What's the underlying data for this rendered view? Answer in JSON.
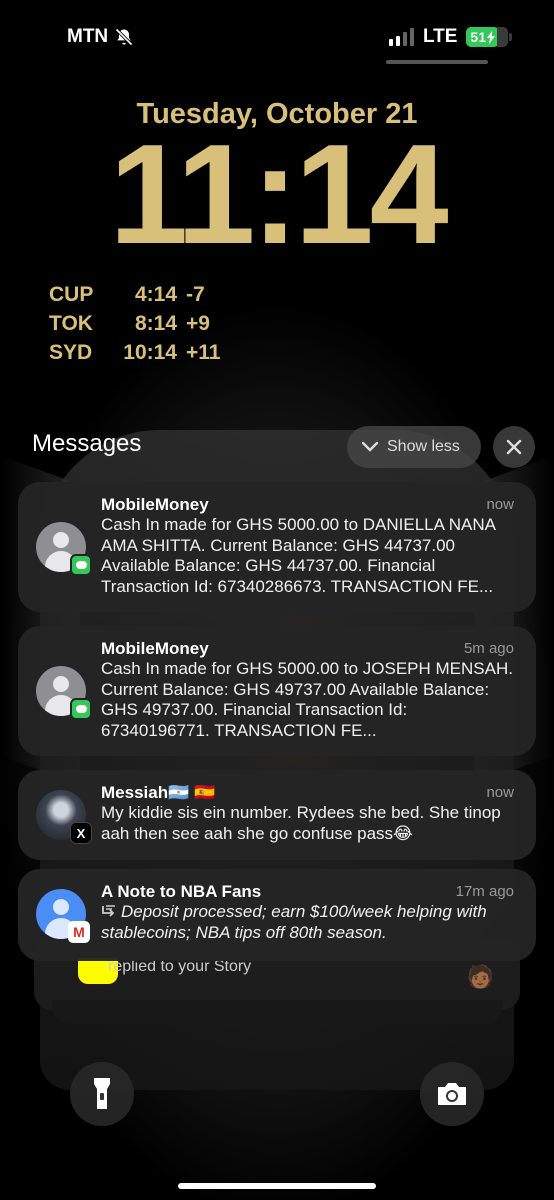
{
  "status_bar": {
    "carrier": "MTN",
    "network": "LTE",
    "battery": "51",
    "silent_icon": "bell-slash-icon",
    "charging_icon": "bolt-icon"
  },
  "lock_screen": {
    "date": "Tuesday, October 21",
    "time": "11:14",
    "world_clocks": [
      {
        "city": "CUP",
        "time": "4:14",
        "offset": "-7"
      },
      {
        "city": "TOK",
        "time": "8:14",
        "offset": "+9"
      },
      {
        "city": "SYD",
        "time": "10:14",
        "offset": "+11"
      }
    ],
    "accent_color": "#d9c07a"
  },
  "notification_group": {
    "title": "Messages",
    "show_less_label": "Show less",
    "close_icon": "close-icon"
  },
  "notifications": [
    {
      "title": "MobileMoney",
      "time": "now",
      "body": "Cash In made for GHS 5000.00 to DANIELLA NANA AMA SHITTA. Current Balance: GHS 44737.00 Available Balance: GHS 44737.00. Financial Transaction Id: 67340286673. TRANSACTION FE..."
    },
    {
      "title": "MobileMoney",
      "time": "5m ago",
      "body": "Cash In made for GHS 5000.00 to JOSEPH MENSAH. Current Balance: GHS 49737.00 Available Balance: GHS 49737.00. Financial Transaction Id: 67340196771. TRANSACTION FE..."
    },
    {
      "title": "Messiah🇦🇷 🇪🇸",
      "time": "now",
      "body": "My kiddie sis ein number. Rydees she bed. She tinop aah then see aah she go confuse pass😂"
    },
    {
      "title": "A Note to NBA Fans",
      "time": "17m ago",
      "count": "2",
      "body": "Deposit processed; earn $100/week helping with stablecoins; NBA tips off 80th season."
    }
  ],
  "stacked_notification": {
    "text": "replied to your Story"
  },
  "quick_actions": {
    "flashlight_icon": "flashlight-icon",
    "camera_icon": "camera-icon"
  }
}
